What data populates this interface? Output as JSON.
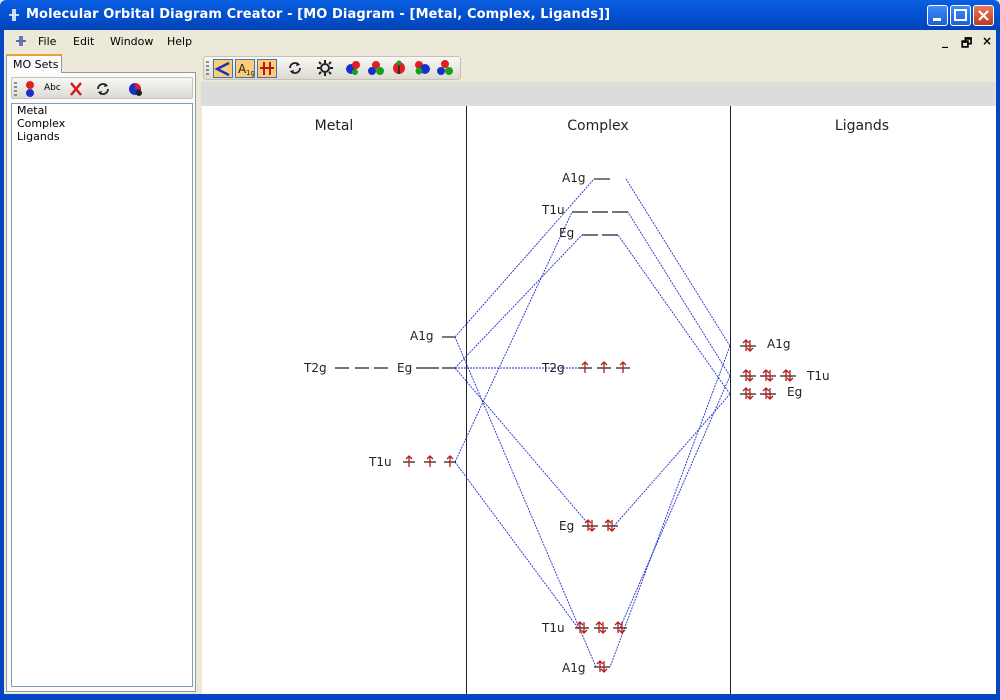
{
  "window": {
    "title": "Molecular Orbital Diagram Creator - [MO Diagram - [Metal, Complex, Ligands]]",
    "controls": [
      "minimize",
      "maximize",
      "close"
    ]
  },
  "menu": {
    "items": [
      "File",
      "Edit",
      "Window",
      "Help"
    ],
    "mdi_controls": [
      "_",
      "🗗",
      "×"
    ]
  },
  "left_panel": {
    "tab_label": "MO Sets",
    "toolbar_icons": [
      "add-orbital-icon",
      "label-abc-icon",
      "delete-icon",
      "refresh-icon",
      "color-icon"
    ],
    "toolbar_abc": "Abc",
    "list_items": [
      "Metal",
      "Complex",
      "Ligands"
    ]
  },
  "diagram_toolbar": {
    "buttons": [
      "connect-lines-icon",
      "label-a1g-icon",
      "electrons-icon",
      "refresh-icon",
      "settings-icon",
      "color-red-icon",
      "color-label-icon",
      "color-ladybug-icon",
      "color-abc-icon",
      "color-balls-icon"
    ],
    "active": [
      "connect-lines-icon",
      "label-a1g-icon",
      "electrons-icon"
    ]
  },
  "diagram": {
    "columns": [
      "Metal",
      "Complex",
      "Ligands"
    ],
    "metal_levels": [
      {
        "label": "A1g",
        "electrons": "none"
      },
      {
        "label": "T2g",
        "electrons": "none"
      },
      {
        "label": "Eg",
        "electrons": "none"
      },
      {
        "label": "T1u",
        "electrons": "single-up"
      }
    ],
    "complex_levels": [
      {
        "label": "A1g",
        "electrons": "none",
        "degeneracy": 1
      },
      {
        "label": "T1u",
        "electrons": "none",
        "degeneracy": 3
      },
      {
        "label": "Eg",
        "electrons": "none",
        "degeneracy": 2
      },
      {
        "label": "T2g",
        "electrons": "single-up",
        "degeneracy": 3
      },
      {
        "label": "Eg",
        "electrons": "paired",
        "degeneracy": 2
      },
      {
        "label": "T1u",
        "electrons": "paired",
        "degeneracy": 3
      },
      {
        "label": "A1g",
        "electrons": "paired",
        "degeneracy": 1
      }
    ],
    "ligand_levels": [
      {
        "label": "A1g",
        "electrons": "paired",
        "degeneracy": 1
      },
      {
        "label": "T1u",
        "electrons": "paired",
        "degeneracy": 3
      },
      {
        "label": "Eg",
        "electrons": "paired",
        "degeneracy": 2
      }
    ],
    "colors": {
      "connector": "#1f2fc8",
      "electron": "#b81818",
      "level": "#222222"
    }
  }
}
